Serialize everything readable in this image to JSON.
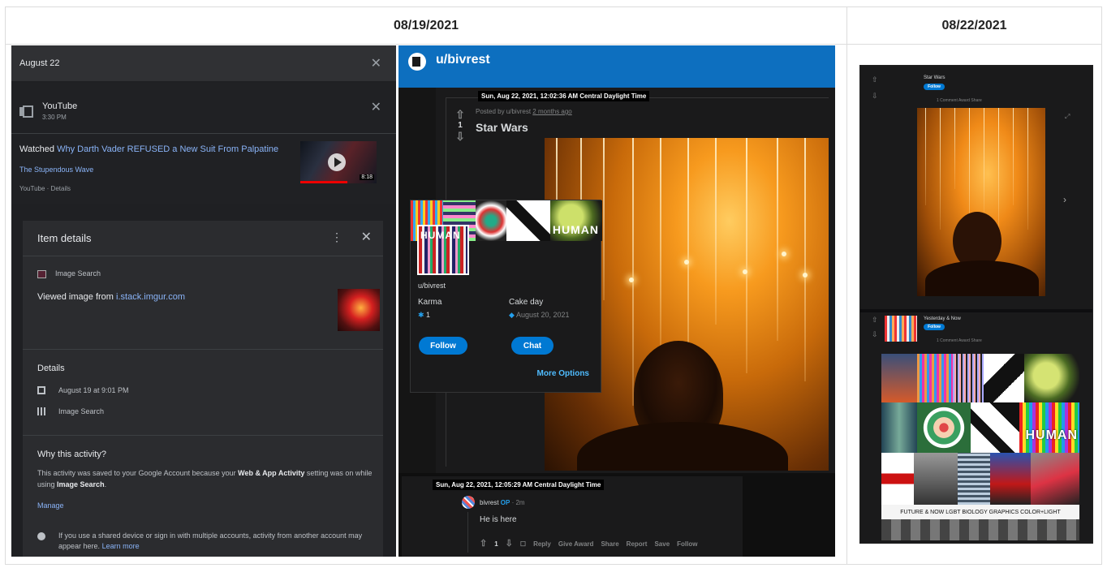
{
  "columns": {
    "left_date": "08/19/2021",
    "right_date": "08/22/2021"
  },
  "google_activity": {
    "top_bar_title": "August 22",
    "youtube_entry": {
      "source": "YouTube",
      "time": "3:30 PM",
      "watched_prefix": "Watched",
      "video_title": "Why Darth Vader REFUSED a New Suit From Palpatine",
      "channel": "The Stupendous Wave",
      "footer": "YouTube · Details",
      "video_duration": "8:18"
    },
    "item_details": {
      "header": "Item details",
      "source_label": "Image Search",
      "viewed_prefix": "Viewed image from",
      "viewed_link": "i.stack.imgur.com",
      "details_heading": "Details",
      "details_date": "August 19 at 9:01 PM",
      "details_product": "Image Search",
      "why_heading": "Why this activity?",
      "why_text_1": "This activity was saved to your Google Account because your",
      "why_bold_1": "Web & App Activity",
      "why_text_2": "setting was on while using",
      "why_bold_2": "Image Search",
      "why_text_3": ".",
      "manage_link": "Manage",
      "note_text": "If you use a shared device or sign in with multiple accounts, activity from another account may appear here.",
      "learn_more": "Learn more"
    }
  },
  "reddit": {
    "username_header": "u/bivrest",
    "post_timestamp": "Sun, Aug 22, 2021, 12:02:36 AM Central Daylight Time",
    "posted_by": "Posted by u/bivrest",
    "posted_ago": "2 months ago",
    "vote_count": "1",
    "post_title": "Star Wars",
    "profile_card": {
      "banner_text": "HUMAN",
      "username": "u/bivrest",
      "karma_label": "Karma",
      "karma_value": "1",
      "cakeday_label": "Cake day",
      "cakeday_value": "August 20, 2021",
      "follow_button": "Follow",
      "chat_button": "Chat",
      "more_options": "More Options"
    },
    "comment": {
      "timestamp": "Sun, Aug 22, 2021, 12:05:29 AM Central Daylight Time",
      "author": "bivrest",
      "op_badge": "OP",
      "age": "· 2m",
      "text": "He is here",
      "votes": "1",
      "actions": [
        "Reply",
        "Give Award",
        "Share",
        "Report",
        "Save",
        "Follow"
      ]
    }
  },
  "right_screenshot": {
    "post1_title": "Star Wars",
    "post1_follow": "Follow",
    "post1_meta": "1 Comment   Award   Share",
    "post2_title": "Yesterday & Now",
    "post2_follow": "Follow",
    "post2_meta": "1 Comment   Award   Share",
    "collage_banner": "HUMAN",
    "collage_caption": "FUTURE & NOW  LGBT  BIOLOGY  GRAPHICS  COLOR+LIGHT"
  }
}
